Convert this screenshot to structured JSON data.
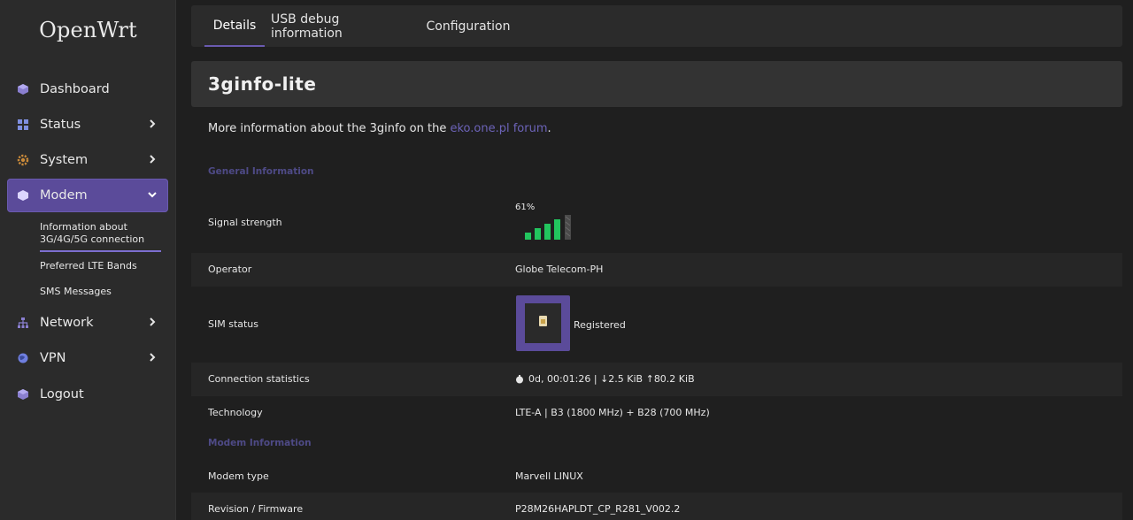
{
  "brand": "OpenWrt",
  "nav": {
    "dashboard": "Dashboard",
    "status": "Status",
    "system": "System",
    "modem": "Modem",
    "network": "Network",
    "vpn": "VPN",
    "logout": "Logout",
    "modem_sub": {
      "info": "Information about 3G/4G/5G connection",
      "lte_bands": "Preferred LTE Bands",
      "sms": "SMS Messages"
    }
  },
  "tabs": [
    "Details",
    "USB debug information",
    "Configuration"
  ],
  "page": {
    "title": "3ginfo-lite",
    "desc_prefix": "More information about the 3ginfo on the ",
    "desc_link": "eko.one.pl forum",
    "desc_suffix": "."
  },
  "general": {
    "heading": "General Information",
    "signal_label": "Signal strength",
    "signal_value": "61%",
    "operator_label": "Operator",
    "operator_value": "Globe Telecom-PH",
    "sim_label": "SIM status",
    "sim_value": "Registered",
    "conn_label": "Connection statistics",
    "conn_value": "0d, 00:01:26 | ↓2.5 KiB ↑80.2 KiB",
    "tech_label": "Technology",
    "tech_value": "LTE-A | B3 (1800 MHz) + B28 (700 MHz)"
  },
  "modem": {
    "heading": "Modem Information",
    "type_label": "Modem type",
    "type_value": "Marvell LINUX",
    "fw_label": "Revision / Firmware",
    "fw_value": "P28M26HAPLDT_CP_R281_V002.2"
  },
  "colors": {
    "accent": "#5b4b9a",
    "signal_green": "#22c55e",
    "link": "#6c63b8"
  },
  "icons": {
    "dashboard": "dashboard-icon",
    "status": "status-icon",
    "system": "gear-icon",
    "modem": "modem-icon",
    "network": "network-icon",
    "vpn": "vpn-icon",
    "logout": "logout-icon"
  }
}
